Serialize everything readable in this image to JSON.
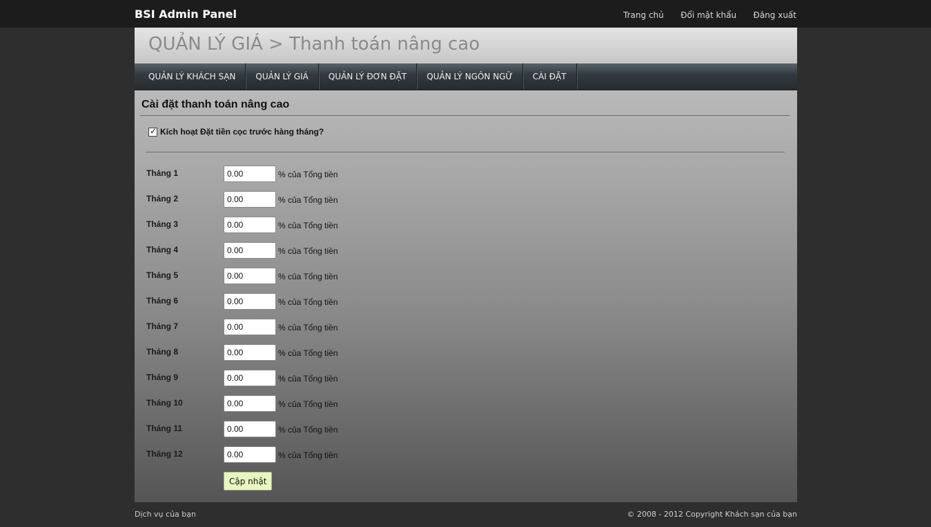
{
  "header": {
    "brand": "BSI Admin Panel",
    "links": [
      "Trang chủ",
      "Đổi mật khẩu",
      "Đăng xuất"
    ]
  },
  "page": {
    "title": "QUẢN LÝ GIÁ > Thanh toán nâng cao"
  },
  "nav": {
    "items": [
      "QUẢN LÝ KHÁCH SẠN",
      "QUẢN LÝ GIÁ",
      "QUẢN LÝ ĐƠN ĐẶT",
      "QUẢN LÝ NGÔN NGỮ",
      "CÀI ĐẶT"
    ]
  },
  "form": {
    "section_title": "Cài đặt thanh toán nâng cao",
    "checkbox_label": "Kích hoạt Đặt tiền cọc trước hàng tháng?",
    "checkbox_checked": true,
    "checkbox_mark": "✓",
    "suffix": "% của Tổng tiền",
    "months": [
      {
        "label": "Tháng 1",
        "value": "0.00"
      },
      {
        "label": "Tháng 2",
        "value": "0.00"
      },
      {
        "label": "Tháng 3",
        "value": "0.00"
      },
      {
        "label": "Tháng 4",
        "value": "0.00"
      },
      {
        "label": "Tháng 5",
        "value": "0.00"
      },
      {
        "label": "Tháng 6",
        "value": "0.00"
      },
      {
        "label": "Tháng 7",
        "value": "0.00"
      },
      {
        "label": "Tháng 8",
        "value": "0.00"
      },
      {
        "label": "Tháng 9",
        "value": "0.00"
      },
      {
        "label": "Tháng 10",
        "value": "0.00"
      },
      {
        "label": "Tháng 11",
        "value": "0.00"
      },
      {
        "label": "Tháng 12",
        "value": "0.00"
      }
    ],
    "submit_label": "Cập nhật"
  },
  "footer": {
    "left": "Dịch vụ của bạn",
    "right": "© 2008 - 2012 Copyright Khách sạn của bạn"
  }
}
